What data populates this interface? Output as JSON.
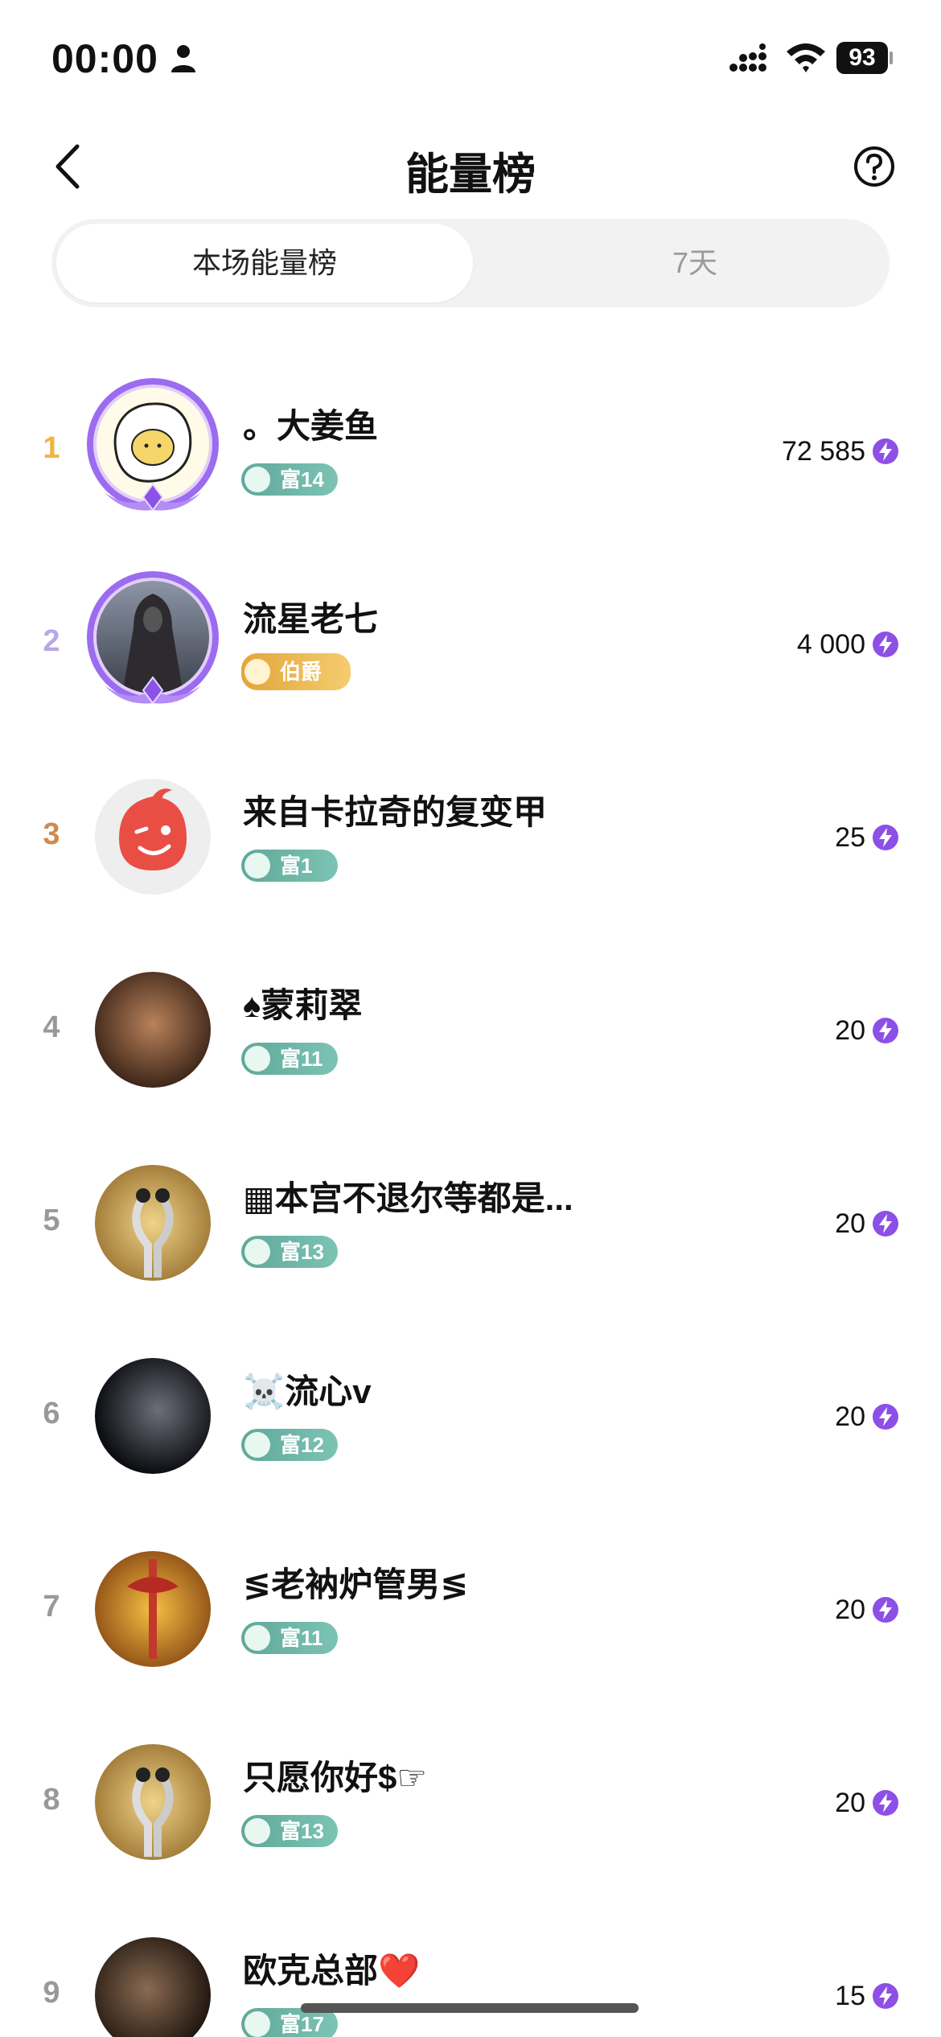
{
  "status": {
    "time": "00:00",
    "battery": "93"
  },
  "nav": {
    "title": "能量榜"
  },
  "tabs": [
    {
      "label": "本场能量榜"
    },
    {
      "label": "7天"
    }
  ],
  "colors": {
    "accent_purple": "#9b6cf0",
    "badge_green": "#5fa99a",
    "badge_gold": "#e2a53b",
    "rank1": "#f0b441",
    "rank2": "#b8a8e6",
    "rank3": "#d08a4e"
  },
  "list": [
    {
      "rank": "1",
      "name": "。大姜鱼",
      "badge": "富14",
      "score": "72 585",
      "avatar": "egg-avatar"
    },
    {
      "rank": "2",
      "name": "流星老七",
      "badge": "伯爵",
      "score": "4 000",
      "avatar": "cloak-avatar"
    },
    {
      "rank": "3",
      "name": "来自卡拉奇的复变甲",
      "badge": "富1",
      "score": "25",
      "avatar": "wink-avatar"
    },
    {
      "rank": "4",
      "name": "♠蒙莉翠",
      "badge": "富11",
      "score": "20",
      "avatar": "torso-avatar"
    },
    {
      "rank": "5",
      "name": "▦本宫不退尔等都是...",
      "badge": "富13",
      "score": "20",
      "avatar": "crane-avatar"
    },
    {
      "rank": "6",
      "name": "☠️流心v",
      "badge": "富12",
      "score": "20",
      "avatar": "dark-avatar"
    },
    {
      "rank": "7",
      "name": "≶老衲炉管男≶",
      "badge": "富11",
      "score": "20",
      "avatar": "sword-avatar"
    },
    {
      "rank": "8",
      "name": "只愿你好$☞",
      "badge": "富13",
      "score": "20",
      "avatar": "crane-avatar"
    },
    {
      "rank": "9",
      "name": "欧克总部❤️",
      "badge": "富17",
      "score": "15",
      "avatar": "face-avatar"
    }
  ]
}
